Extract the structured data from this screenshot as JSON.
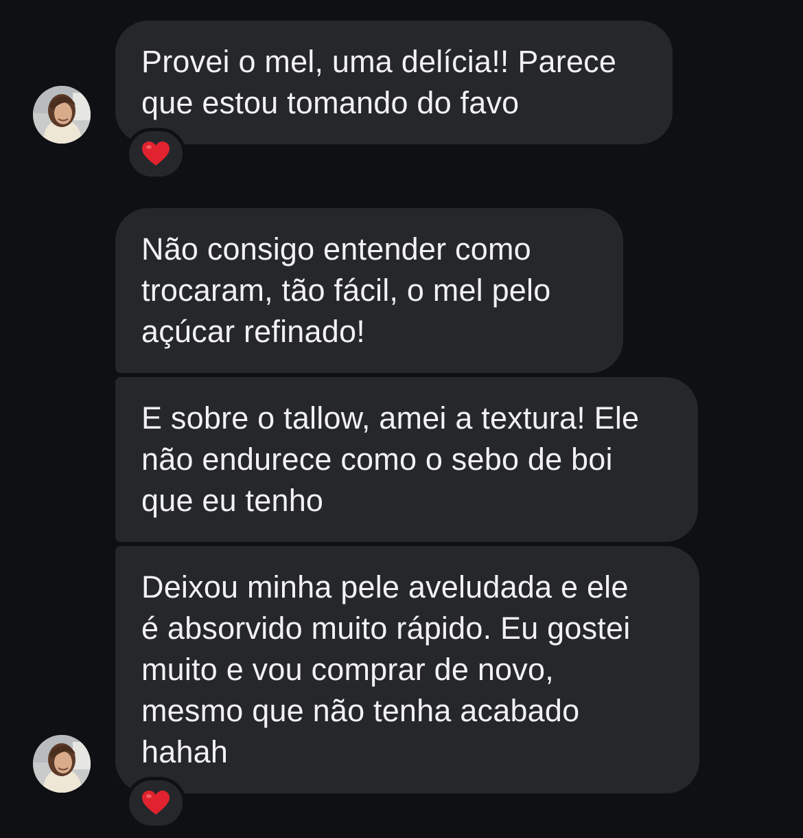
{
  "conversation": {
    "messages": [
      {
        "text": "Provei o mel, uma delícia!! Parece\nque estou tomando do favo",
        "reaction": "heart"
      },
      {
        "text": "Não consigo entender como\ntrocaram,  tão fácil, o mel pelo\naçúcar refinado!"
      },
      {
        "text": "E sobre o tallow, amei a textura! Ele\nnão endurece como o sebo de boi\nque eu tenho"
      },
      {
        "text": "Deixou minha pele aveludada e ele\né absorvido muito rápido. Eu gostei\nmuito e vou comprar de novo,\nmesmo que não tenha acabado\nhahah",
        "reaction": "heart"
      }
    ],
    "colors": {
      "background": "#0e1014",
      "bubble": "#25272b",
      "text": "#f2f2f4",
      "heart": "#e0232e"
    },
    "icons": [
      "avatar-photo",
      "heart-icon"
    ]
  }
}
